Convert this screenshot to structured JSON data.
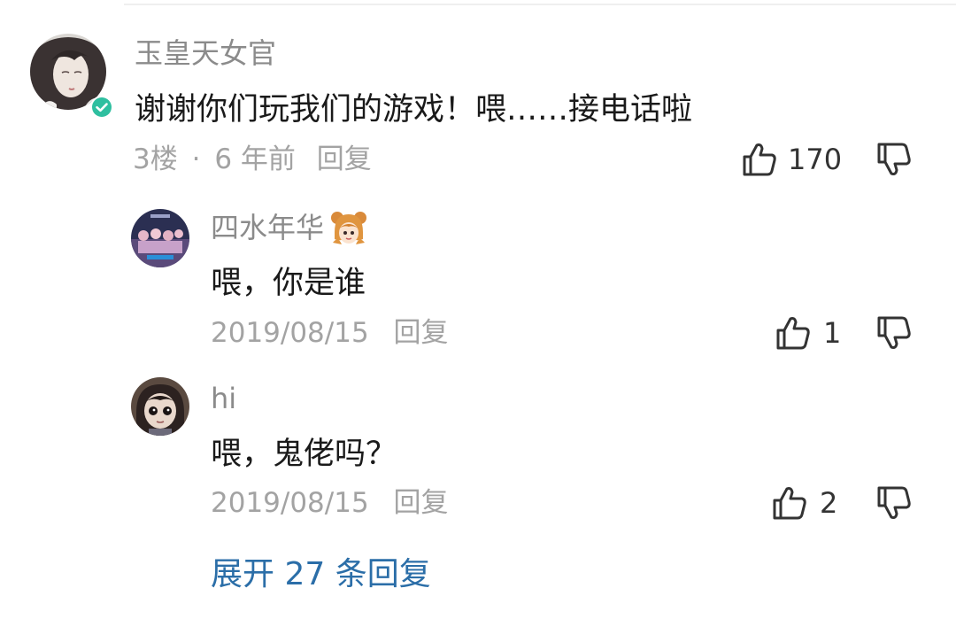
{
  "main_comment": {
    "username": "玉皇天女官",
    "text": "谢谢你们玩我们的游戏！喂……接电话啦",
    "floor": "3楼",
    "separator": "·",
    "time": "6 年前",
    "reply_label": "回复",
    "like_count": "170",
    "verified": true
  },
  "replies": [
    {
      "username": "四水年华",
      "text": "喂，你是谁",
      "date": "2019/08/15",
      "reply_label": "回复",
      "like_count": "1"
    },
    {
      "username": "hi",
      "text": "喂，鬼佬吗？",
      "date": "2019/08/15",
      "reply_label": "回复",
      "like_count": "2"
    }
  ],
  "expand": {
    "label": "展开 27 条回复"
  },
  "colors": {
    "username": "#8b8b8b",
    "text": "#1a1a1a",
    "meta": "#a3a3a3",
    "link": "#2b6ea8",
    "verified": "#2fbfa0"
  },
  "icons": {
    "like": "thumb-up-icon",
    "dislike": "thumb-down-icon",
    "verified": "verified-check-icon",
    "medal": "cartoon-girl-medal-icon"
  }
}
